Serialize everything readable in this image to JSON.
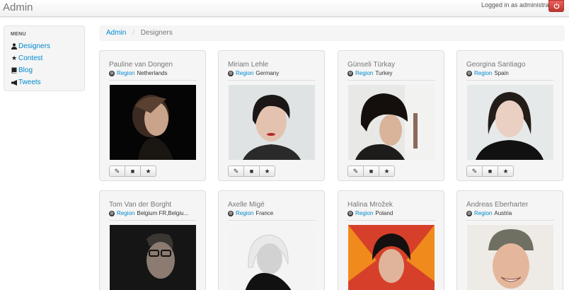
{
  "navbar": {
    "brand": "Admin",
    "logged_in_text": "Logged in as administrator",
    "logout_icon": "power-icon",
    "logout_color": "#da4f49"
  },
  "sidebar": {
    "header": "MENU",
    "items": [
      {
        "label": "Designers",
        "icon": "user-icon"
      },
      {
        "label": "Contest",
        "icon": "star-icon"
      },
      {
        "label": "Blog",
        "icon": "book-icon"
      },
      {
        "label": "Tweets",
        "icon": "bullhorn-icon"
      }
    ]
  },
  "breadcrumb": {
    "root": "Admin",
    "separator": "/",
    "current": "Designers"
  },
  "designers": [
    {
      "name": "Pauline van Dongen",
      "region_label": "Region",
      "region": "Netherlands"
    },
    {
      "name": "Miriam Lehle",
      "region_label": "Region",
      "region": "Germany"
    },
    {
      "name": "Günseli Türkay",
      "region_label": "Region",
      "region": "Turkey"
    },
    {
      "name": "Georgina Santiago",
      "region_label": "Region",
      "region": "Spain"
    },
    {
      "name": "Tom Van der Borght",
      "region_label": "Region",
      "region": "Belgium FR,Belgiu..."
    },
    {
      "name": "Axelle Migé",
      "region_label": "Region",
      "region": "France"
    },
    {
      "name": "Halina Mrožek",
      "region_label": "Region",
      "region": "Poland"
    },
    {
      "name": "Andreas Eberharter",
      "region_label": "Region",
      "region": "Austria"
    }
  ],
  "card_actions": [
    "edit-icon",
    "book-icon",
    "star-icon"
  ],
  "colors": {
    "link": "#0088cc",
    "accent_danger": "#da4f49"
  }
}
